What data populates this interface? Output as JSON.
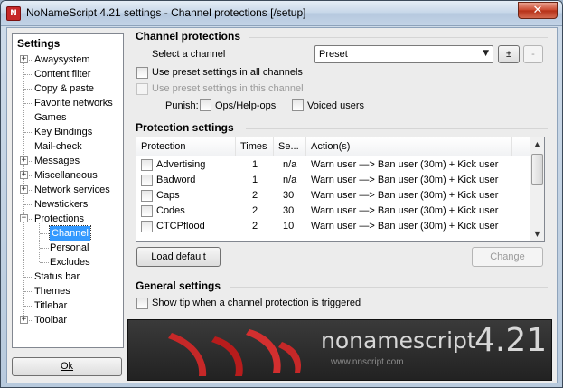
{
  "window": {
    "title": "NoNameScript 4.21 settings - Channel protections [/setup]",
    "close_glyph": "✕",
    "app_icon_glyph": "N"
  },
  "tree": {
    "title": "Settings",
    "items": [
      {
        "label": "Awaysystem",
        "expander": "+"
      },
      {
        "label": "Content filter"
      },
      {
        "label": "Copy & paste"
      },
      {
        "label": "Favorite networks"
      },
      {
        "label": "Games"
      },
      {
        "label": "Key Bindings"
      },
      {
        "label": "Mail-check"
      },
      {
        "label": "Messages",
        "expander": "+"
      },
      {
        "label": "Miscellaneous",
        "expander": "+"
      },
      {
        "label": "Network services",
        "expander": "+"
      },
      {
        "label": "Newstickers"
      },
      {
        "label": "Protections",
        "expander": "−"
      },
      {
        "label": "Channel",
        "selected": true
      },
      {
        "label": "Personal"
      },
      {
        "label": "Excludes"
      },
      {
        "label": "Status bar"
      },
      {
        "label": "Themes"
      },
      {
        "label": "Titlebar"
      },
      {
        "label": "Toolbar",
        "expander": "+"
      }
    ],
    "ok_label": "Ok"
  },
  "channel_protections": {
    "title": "Channel protections",
    "select_label": "Select a channel",
    "select_value": "Preset",
    "add_label": "±",
    "more_label": "-",
    "use_preset_all": "Use preset settings in all channels",
    "use_preset_this": "Use preset settings in this channel",
    "punish_label": "Punish:",
    "ops_label": "Ops/Help-ops",
    "voiced_label": "Voiced users"
  },
  "protection_settings": {
    "title": "Protection settings",
    "columns": [
      "Protection",
      "Times",
      "Se...",
      "Action(s)"
    ],
    "rows": [
      {
        "name": "Advertising",
        "times": "1",
        "secs": "n/a",
        "action": "Warn user —> Ban user (30m) + Kick user"
      },
      {
        "name": "Badword",
        "times": "1",
        "secs": "n/a",
        "action": "Warn user —> Ban user (30m) + Kick user"
      },
      {
        "name": "Caps",
        "times": "2",
        "secs": "30",
        "action": "Warn user —> Ban user (30m) + Kick user"
      },
      {
        "name": "Codes",
        "times": "2",
        "secs": "30",
        "action": "Warn user —> Ban user (30m) + Kick user"
      },
      {
        "name": "CTCPflood",
        "times": "2",
        "secs": "10",
        "action": "Warn user —> Ban user (30m) + Kick user"
      }
    ],
    "load_default_label": "Load default",
    "change_label": "Change"
  },
  "general_settings": {
    "title": "General settings",
    "show_tip_label": "Show tip when a channel protection is triggered"
  },
  "banner": {
    "logo_text": "nonamescript",
    "version": "4.21",
    "url": "www.nnscript.com"
  },
  "colors": {
    "selection": "#3399ff",
    "banner_bg": "#2b2b2b",
    "banner_accent": "#c62828"
  }
}
